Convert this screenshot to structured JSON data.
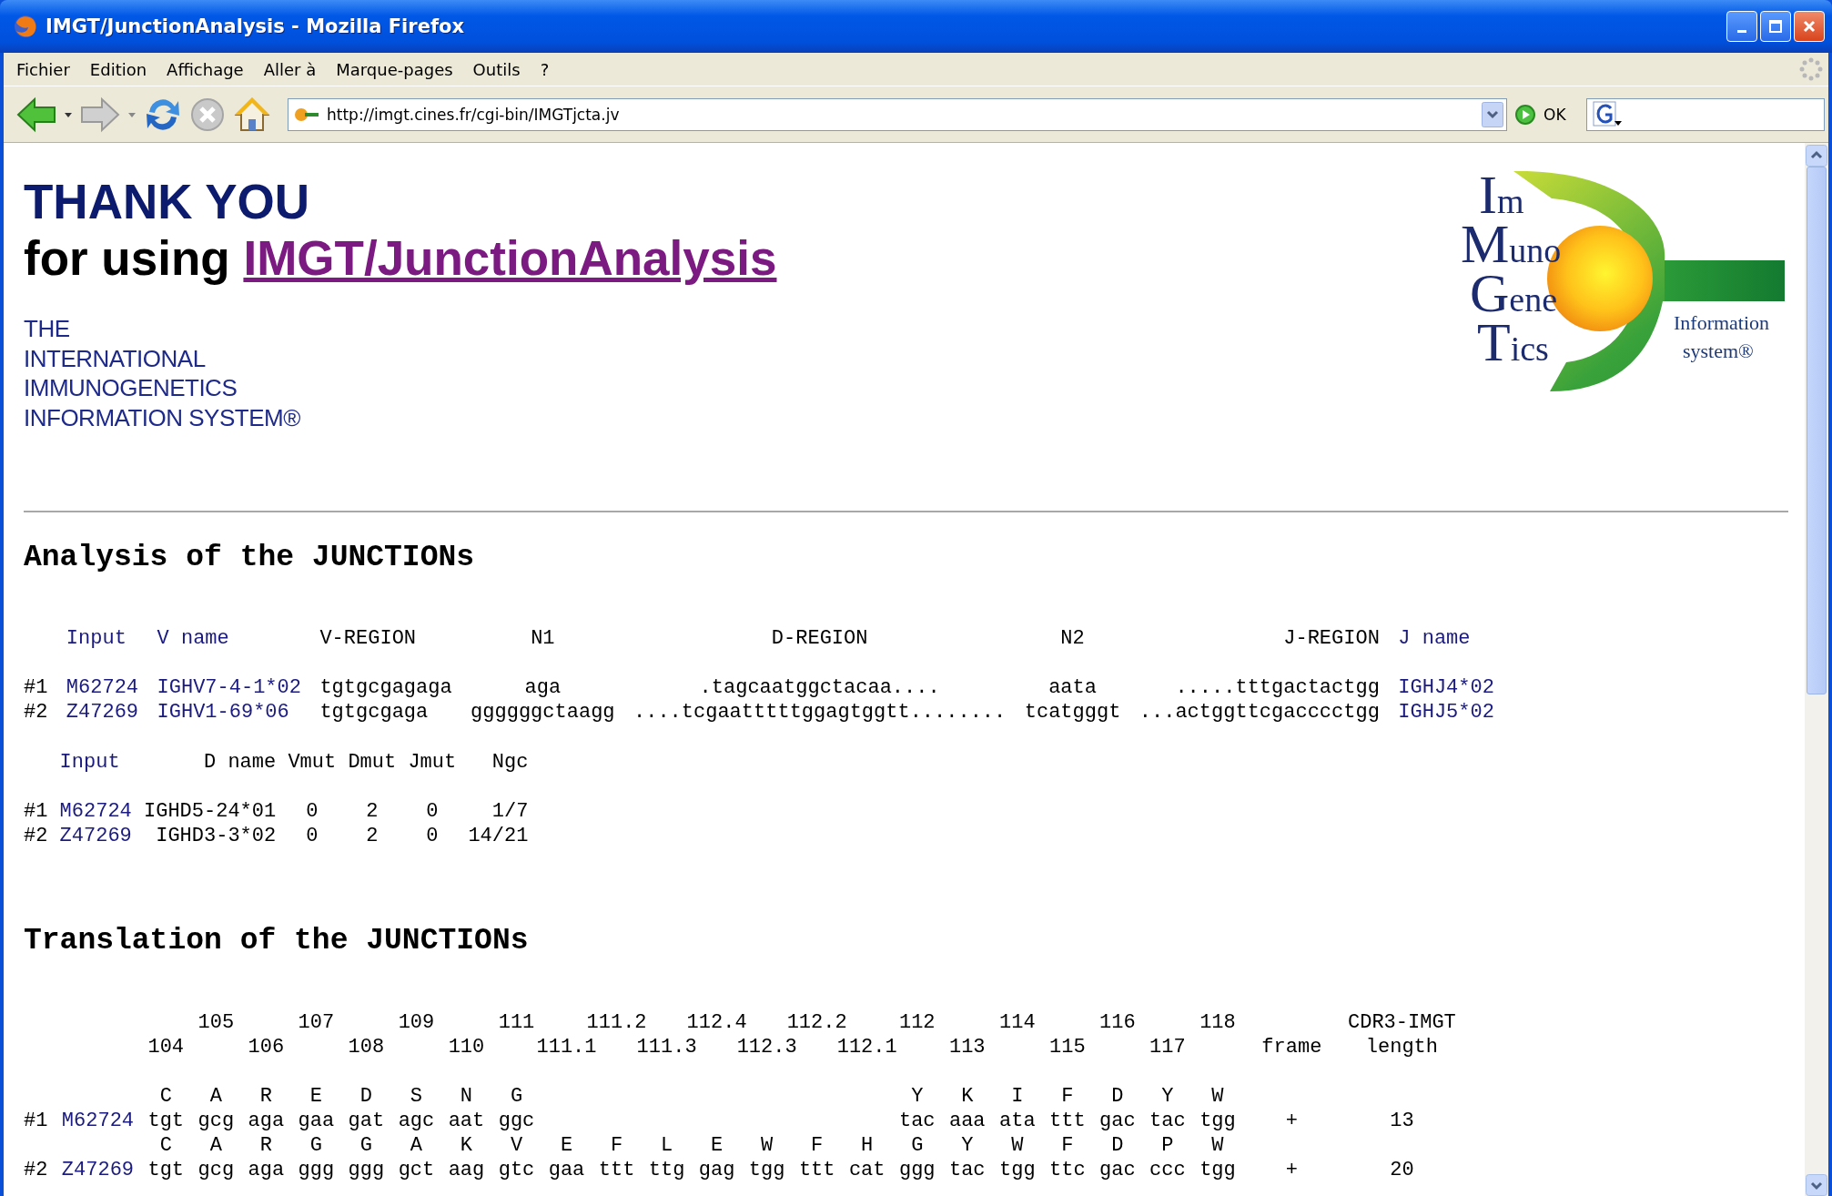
{
  "window": {
    "title": "IMGT/JunctionAnalysis - Mozilla Firefox"
  },
  "menu": [
    "Fichier",
    "Edition",
    "Affichage",
    "Aller à",
    "Marque-pages",
    "Outils",
    "?"
  ],
  "toolbar": {
    "address": "http://imgt.cines.fr/cgi-bin/IMGTjcta.jv",
    "go_label": "OK"
  },
  "page": {
    "heading": "THANK YOU",
    "subheading_prefix": "for using",
    "subheading_link": "IMGT/JunctionAnalysis",
    "org_lines": [
      "THE",
      "INTERNATIONAL",
      "IMMUNOGENETICS",
      "INFORMATION SYSTEM®"
    ],
    "logo": {
      "lines": [
        "Im",
        "Muno",
        "Gene",
        "Tics"
      ],
      "tagline": [
        "Information",
        "system®"
      ]
    },
    "analysis": {
      "title": "Analysis of the JUNCTIONs",
      "junctions": {
        "columns": [
          "Input",
          "V name",
          "V-REGION",
          "N1",
          "D-REGION",
          "N2",
          "J-REGION",
          "J name"
        ],
        "rows": [
          {
            "index": "#1",
            "input": "M62724",
            "v_name": "IGHV7-4-1*02",
            "v_region": "tgtgcgagaga",
            "n1": "aga",
            "d_region": ".tagcaatggctacaa....",
            "n2": "aata",
            "j_region": ".....tttgactactgg",
            "j_name": "IGHJ4*02"
          },
          {
            "index": "#2",
            "input": "Z47269",
            "v_name": "IGHV1-69*06",
            "v_region": "tgtgcgaga",
            "n1": "ggggggctaagg",
            "d_region": "....tcgaatttttggagtggtt........",
            "n2": "tcatgggt",
            "j_region": "...actggttcgacccctgg",
            "j_name": "IGHJ5*02"
          }
        ]
      },
      "genes": {
        "columns": [
          "Input",
          "D name",
          "Vmut",
          "Dmut",
          "Jmut",
          "Ngc"
        ],
        "rows": [
          {
            "index": "#1",
            "input": "M62724",
            "d_name": "IGHD5-24*01",
            "v_mut": "0",
            "d_mut": "2",
            "j_mut": "0",
            "ngc": "1/7"
          },
          {
            "index": "#2",
            "input": "Z47269",
            "d_name": "IGHD3-3*02",
            "v_mut": "0",
            "d_mut": "2",
            "j_mut": "0",
            "ngc": "14/21"
          }
        ]
      }
    },
    "translation": {
      "title": "Translation of the JUNCTIONs",
      "positions": [
        "104",
        "105",
        "106",
        "107",
        "108",
        "109",
        "110",
        "111",
        "111.1",
        "111.2",
        "111.3",
        "112.4",
        "112.3",
        "112.2",
        "112.1",
        "112",
        "113",
        "114",
        "115",
        "116",
        "117",
        "118"
      ],
      "frame_header": "frame",
      "cdr3_header": [
        "CDR3-IMGT",
        "length"
      ],
      "rows": [
        {
          "index": "#1",
          "input": "M62724",
          "codons_start": [
            {
              "aa": "C",
              "codon": "tgt"
            },
            {
              "aa": "A",
              "codon": "gcg"
            },
            {
              "aa": "R",
              "codon": "aga"
            },
            {
              "aa": "E",
              "codon": "gaa"
            },
            {
              "aa": "D",
              "codon": "gat"
            },
            {
              "aa": "S",
              "codon": "agc"
            },
            {
              "aa": "N",
              "codon": "aat"
            },
            {
              "aa": "G",
              "codon": "ggc"
            }
          ],
          "codons_end": [
            {
              "aa": "Y",
              "codon": "tac"
            },
            {
              "aa": "K",
              "codon": "aaa"
            },
            {
              "aa": "I",
              "codon": "ata"
            },
            {
              "aa": "F",
              "codon": "ttt"
            },
            {
              "aa": "D",
              "codon": "gac"
            },
            {
              "aa": "Y",
              "codon": "tac"
            },
            {
              "aa": "W",
              "codon": "tgg"
            }
          ],
          "frame": "+",
          "cdr3_length": "13"
        },
        {
          "index": "#2",
          "input": "Z47269",
          "codons_start": [
            {
              "aa": "C",
              "codon": "tgt"
            },
            {
              "aa": "A",
              "codon": "gcg"
            },
            {
              "aa": "R",
              "codon": "aga"
            },
            {
              "aa": "G",
              "codon": "ggg"
            },
            {
              "aa": "G",
              "codon": "ggg"
            },
            {
              "aa": "A",
              "codon": "gct"
            },
            {
              "aa": "K",
              "codon": "aag"
            },
            {
              "aa": "V",
              "codon": "gtc"
            },
            {
              "aa": "E",
              "codon": "gaa"
            },
            {
              "aa": "F",
              "codon": "ttt"
            },
            {
              "aa": "L",
              "codon": "ttg"
            },
            {
              "aa": "E",
              "codon": "gag"
            },
            {
              "aa": "W",
              "codon": "tgg"
            },
            {
              "aa": "F",
              "codon": "ttt"
            },
            {
              "aa": "H",
              "codon": "cat"
            },
            {
              "aa": "G",
              "codon": "ggg"
            },
            {
              "aa": "Y",
              "codon": "tac"
            },
            {
              "aa": "W",
              "codon": "tgg"
            },
            {
              "aa": "F",
              "codon": "ttc"
            },
            {
              "aa": "D",
              "codon": "gac"
            },
            {
              "aa": "P",
              "codon": "ccc"
            },
            {
              "aa": "W",
              "codon": "tgg"
            }
          ],
          "frame": "+",
          "cdr3_length": "20"
        }
      ]
    }
  }
}
